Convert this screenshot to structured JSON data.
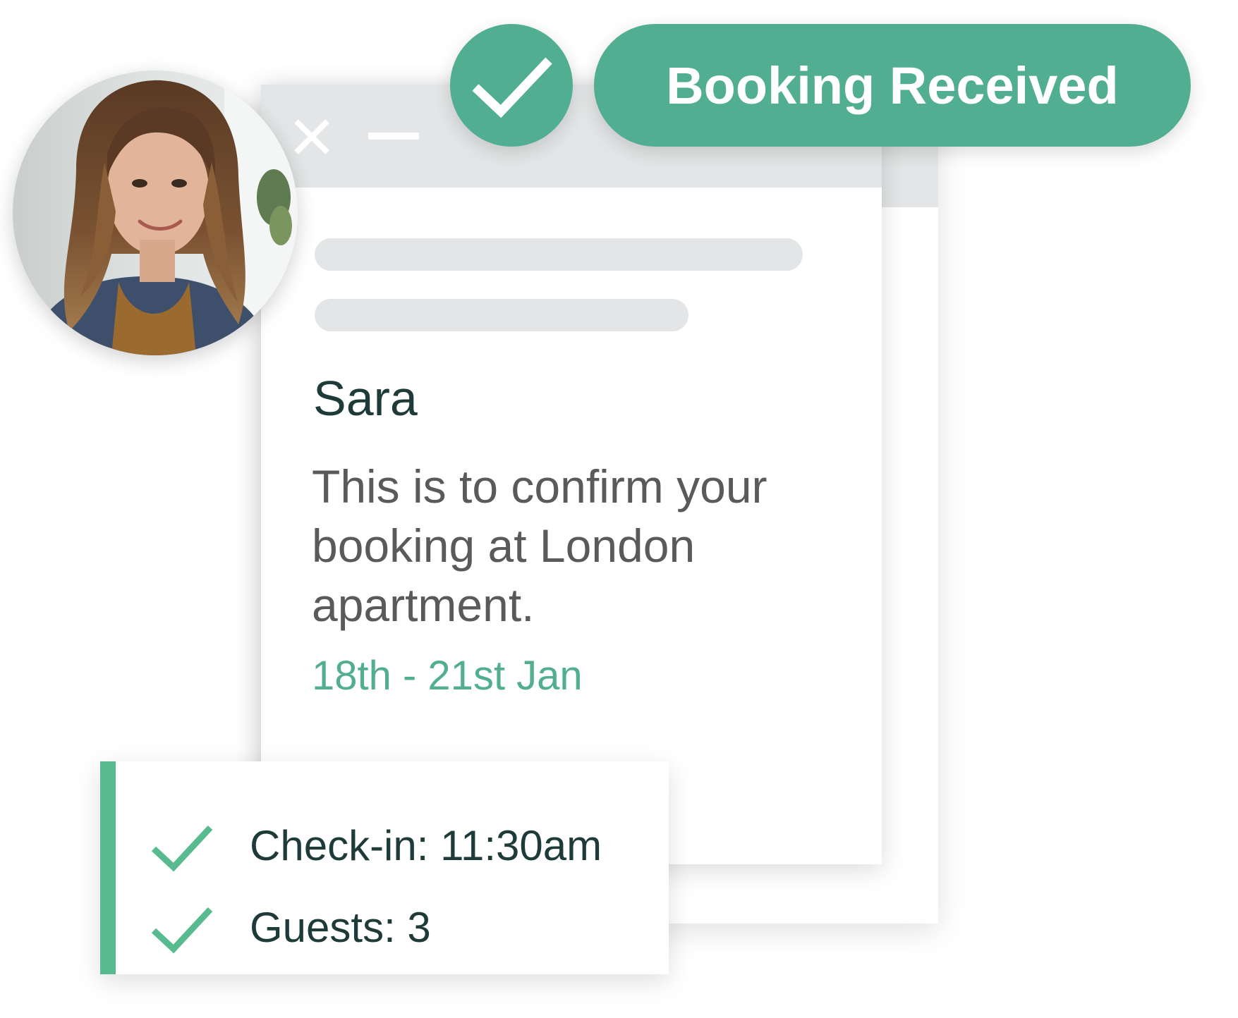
{
  "status": {
    "label": "Booking Received"
  },
  "booking": {
    "guest_name": "Sara",
    "message": "This is to confirm your booking at London apartment.",
    "dates": "18th - 21st Jan"
  },
  "details": [
    {
      "label": "Check-in: 11:30am"
    },
    {
      "label": "Guests: 3"
    }
  ],
  "icons": {
    "status": "checkmark-icon",
    "close": "close-icon",
    "minimize": "minimize-icon",
    "detail_check": "checkmark-icon"
  },
  "colors": {
    "accent": "#52ae91",
    "detail_accent": "#57bb8f",
    "titlebar": "#e3e5e6",
    "heading_text": "#1f3b39",
    "body_text": "#5a5a5a"
  }
}
